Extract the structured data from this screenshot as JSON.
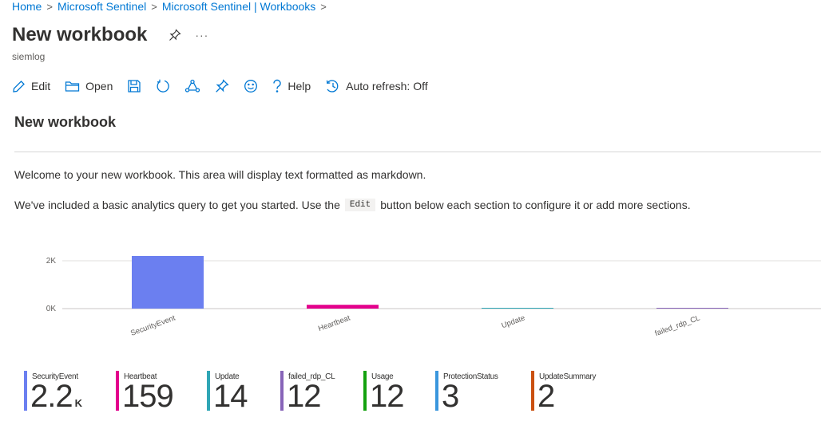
{
  "breadcrumb": {
    "items": [
      "Home",
      "Microsoft Sentinel",
      "Microsoft Sentinel | Workbooks"
    ],
    "separator": ">"
  },
  "header": {
    "title": "New workbook",
    "subtitle": "siemlog",
    "more_label": "···"
  },
  "toolbar": {
    "edit_label": "Edit",
    "open_label": "Open",
    "help_label": "Help",
    "auto_refresh_label": "Auto refresh: Off"
  },
  "content": {
    "section_title": "New workbook",
    "para1": "Welcome to your new workbook. This area will display text formatted as markdown.",
    "para2_pre": "We've included a basic analytics query to get you started. Use the",
    "para2_code": "Edit",
    "para2_post": "button below each section to configure it or add more sections."
  },
  "chart_data": {
    "type": "bar",
    "categories": [
      "SecurityEvent",
      "Heartbeat",
      "Update",
      "failed_rdp_CL"
    ],
    "values": [
      2200,
      159,
      14,
      12
    ],
    "colors": [
      "#6b7ff0",
      "#e3008c",
      "#2fa6b5",
      "#8764b8"
    ],
    "yticks": [
      "2K",
      "0K"
    ],
    "ylim": [
      0,
      2900
    ],
    "grid": true,
    "legend": "none"
  },
  "tiles": [
    {
      "label": "SecurityEvent",
      "value": "2.2",
      "unit": "K",
      "color": "#6b7ff0"
    },
    {
      "label": "Heartbeat",
      "value": "159",
      "unit": "",
      "color": "#e3008c"
    },
    {
      "label": "Update",
      "value": "14",
      "unit": "",
      "color": "#2fa6b5"
    },
    {
      "label": "failed_rdp_CL",
      "value": "12",
      "unit": "",
      "color": "#8764b8"
    },
    {
      "label": "Usage",
      "value": "12",
      "unit": "",
      "color": "#13a10e"
    },
    {
      "label": "ProtectionStatus",
      "value": "3",
      "unit": "",
      "color": "#3a96dd"
    },
    {
      "label": "UpdateSummary",
      "value": "2",
      "unit": "",
      "color": "#ca5010"
    }
  ]
}
